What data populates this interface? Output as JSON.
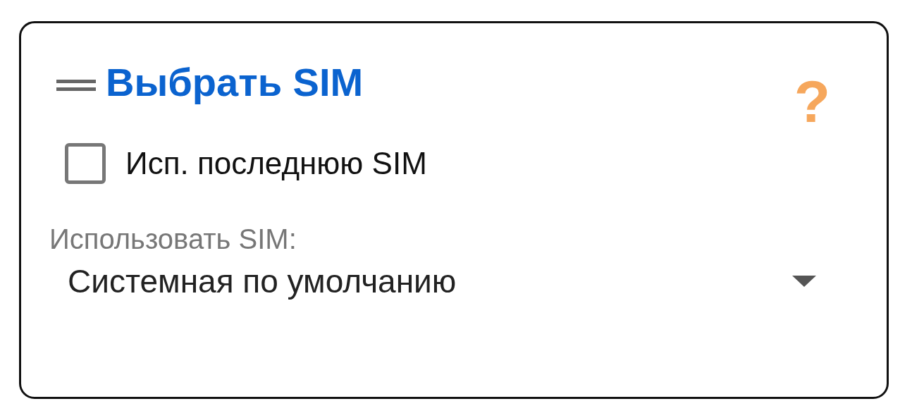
{
  "card": {
    "title": "Выбрать SIM",
    "help": "?"
  },
  "checkbox": {
    "label": "Исп. последнюю SIM",
    "checked": false
  },
  "sim_select": {
    "label": "Использовать SIM:",
    "value": "Системная по умолчанию"
  }
}
